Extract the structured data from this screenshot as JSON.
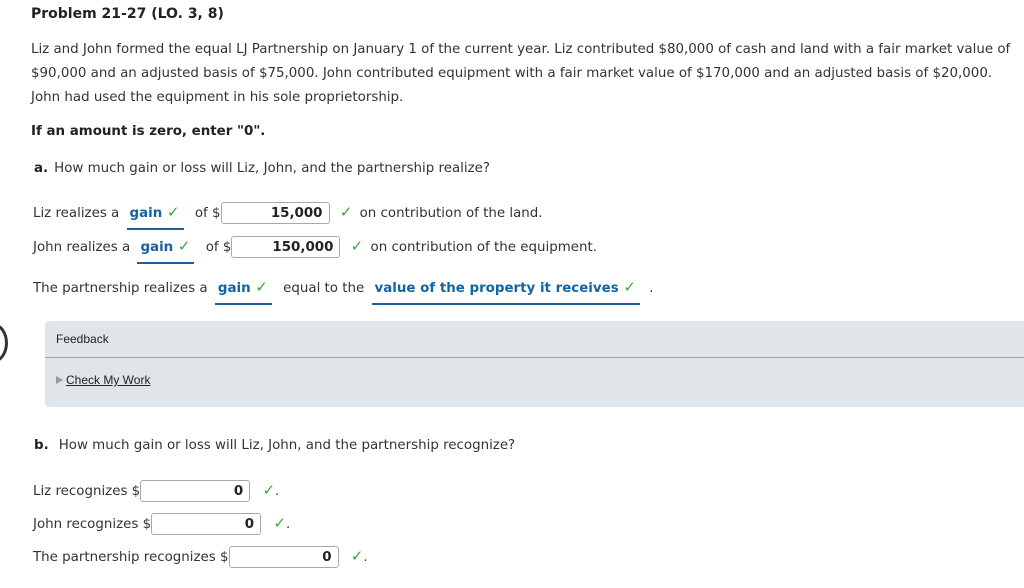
{
  "problem": {
    "title": "Problem 21-27 (LO. 3, 8)",
    "description": "Liz and John formed the equal LJ Partnership on January 1 of the current year. Liz contributed $80,000 of cash and land with a fair market value of $90,000 and an adjusted basis of $75,000. John contributed equipment with a fair market value of $170,000 and an adjusted basis of $20,000. John had used the equipment in his sole proprietorship.",
    "instruction": "If an amount is zero, enter \"0\"."
  },
  "part_a": {
    "letter": "a.",
    "question": "How much gain or loss will Liz, John, and the partnership realize?",
    "liz": {
      "prefix": "Liz realizes a",
      "selection": "gain",
      "of": "of $",
      "amount": "15,000",
      "suffix": "on contribution of the land."
    },
    "john": {
      "prefix": "John realizes a",
      "selection": "gain",
      "of": "of $",
      "amount": "150,000",
      "suffix": "on contribution of the equipment."
    },
    "partnership": {
      "prefix": "The partnership realizes a",
      "selection": "gain",
      "middle": "equal to the",
      "selection2": "value of the property it receives",
      "suffix": "."
    }
  },
  "feedback": {
    "title": "Feedback",
    "link": "Check My Work"
  },
  "part_b": {
    "letter": "b.",
    "question": "How much gain or loss will Liz, John, and the partnership recognize?",
    "liz": {
      "label": "Liz recognizes $",
      "amount": "0",
      "suffix": "."
    },
    "john": {
      "label": "John recognizes $",
      "amount": "0",
      "suffix": "."
    },
    "partnership": {
      "label": "The partnership recognizes $",
      "amount": "0",
      "suffix": "."
    }
  },
  "icons": {
    "check": "✓"
  },
  "colors": {
    "accent": "#1464a0",
    "check": "#3aa63a",
    "feedback_bg": "#dfe5e8"
  }
}
